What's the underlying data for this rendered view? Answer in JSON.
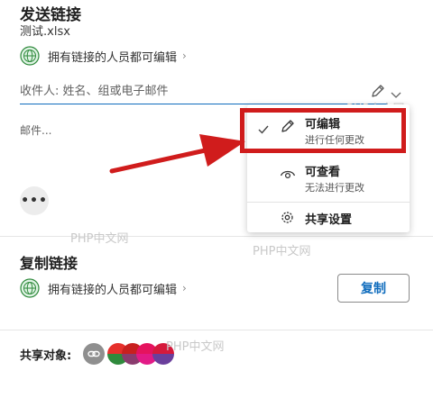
{
  "send_link": {
    "title": "发送链接",
    "filename": "测试.xlsx",
    "permission_text": "拥有链接的人员都可编辑",
    "recipient_placeholder": "收件人: 姓名、组或电子邮件",
    "message_placeholder": "邮件..."
  },
  "dropdown": {
    "items": [
      {
        "title": "可编辑",
        "subtitle": "进行任何更改",
        "selected": true
      },
      {
        "title": "可查看",
        "subtitle": "无法进行更改",
        "selected": false
      }
    ],
    "settings_label": "共享设置"
  },
  "copy_link": {
    "title": "复制链接",
    "permission_text": "拥有链接的人员都可编辑",
    "button_label": "复制"
  },
  "shared_with": {
    "label": "共享对象:",
    "avatars": [
      {
        "color": "#e6302b"
      },
      {
        "color": "#8a3b6e"
      },
      {
        "color": "#e5135e"
      },
      {
        "color": "#d51a3c"
      }
    ]
  },
  "watermarks": [
    "PHP中文网",
    "PHP中文网",
    "PHP中文网",
    "PHP中文网"
  ],
  "colors": {
    "accent": "#0f6cbd",
    "annotation_red": "#d01c1c"
  }
}
